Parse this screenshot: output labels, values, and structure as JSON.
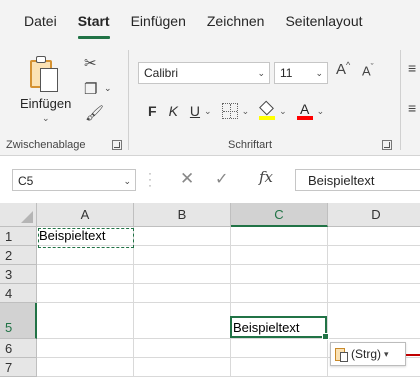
{
  "ribbon_tabs": [
    {
      "label": "Datei",
      "active": false
    },
    {
      "label": "Start",
      "active": true
    },
    {
      "label": "Einfügen",
      "active": false
    },
    {
      "label": "Zeichnen",
      "active": false
    },
    {
      "label": "Seitenlayout",
      "active": false
    }
  ],
  "clipboard_group": {
    "paste_label": "Einfügen",
    "group_label": "Zwischenablage"
  },
  "font_group": {
    "font_name": "Calibri",
    "font_size": "11",
    "grow_label": "A^",
    "shrink_label": "A˅",
    "bold_label": "F",
    "italic_label": "K",
    "underline_label": "U",
    "font_color_label": "A",
    "fill_color": "#FFFF00",
    "font_color": "#FF0000",
    "group_label": "Schriftart"
  },
  "formula_bar": {
    "name_box": "C5",
    "fx_label": "fx",
    "content": "Beispieltext"
  },
  "sheet": {
    "columns": [
      "A",
      "B",
      "C",
      "D"
    ],
    "rows": [
      "1",
      "2",
      "3",
      "4",
      "5",
      "6",
      "7"
    ],
    "selected_column": "C",
    "selected_row": "5",
    "cells": {
      "A1": "Beispieltext",
      "C5": "Beispieltext"
    },
    "accent_color": "#217346"
  },
  "paste_options": {
    "label": "(Strg)"
  }
}
